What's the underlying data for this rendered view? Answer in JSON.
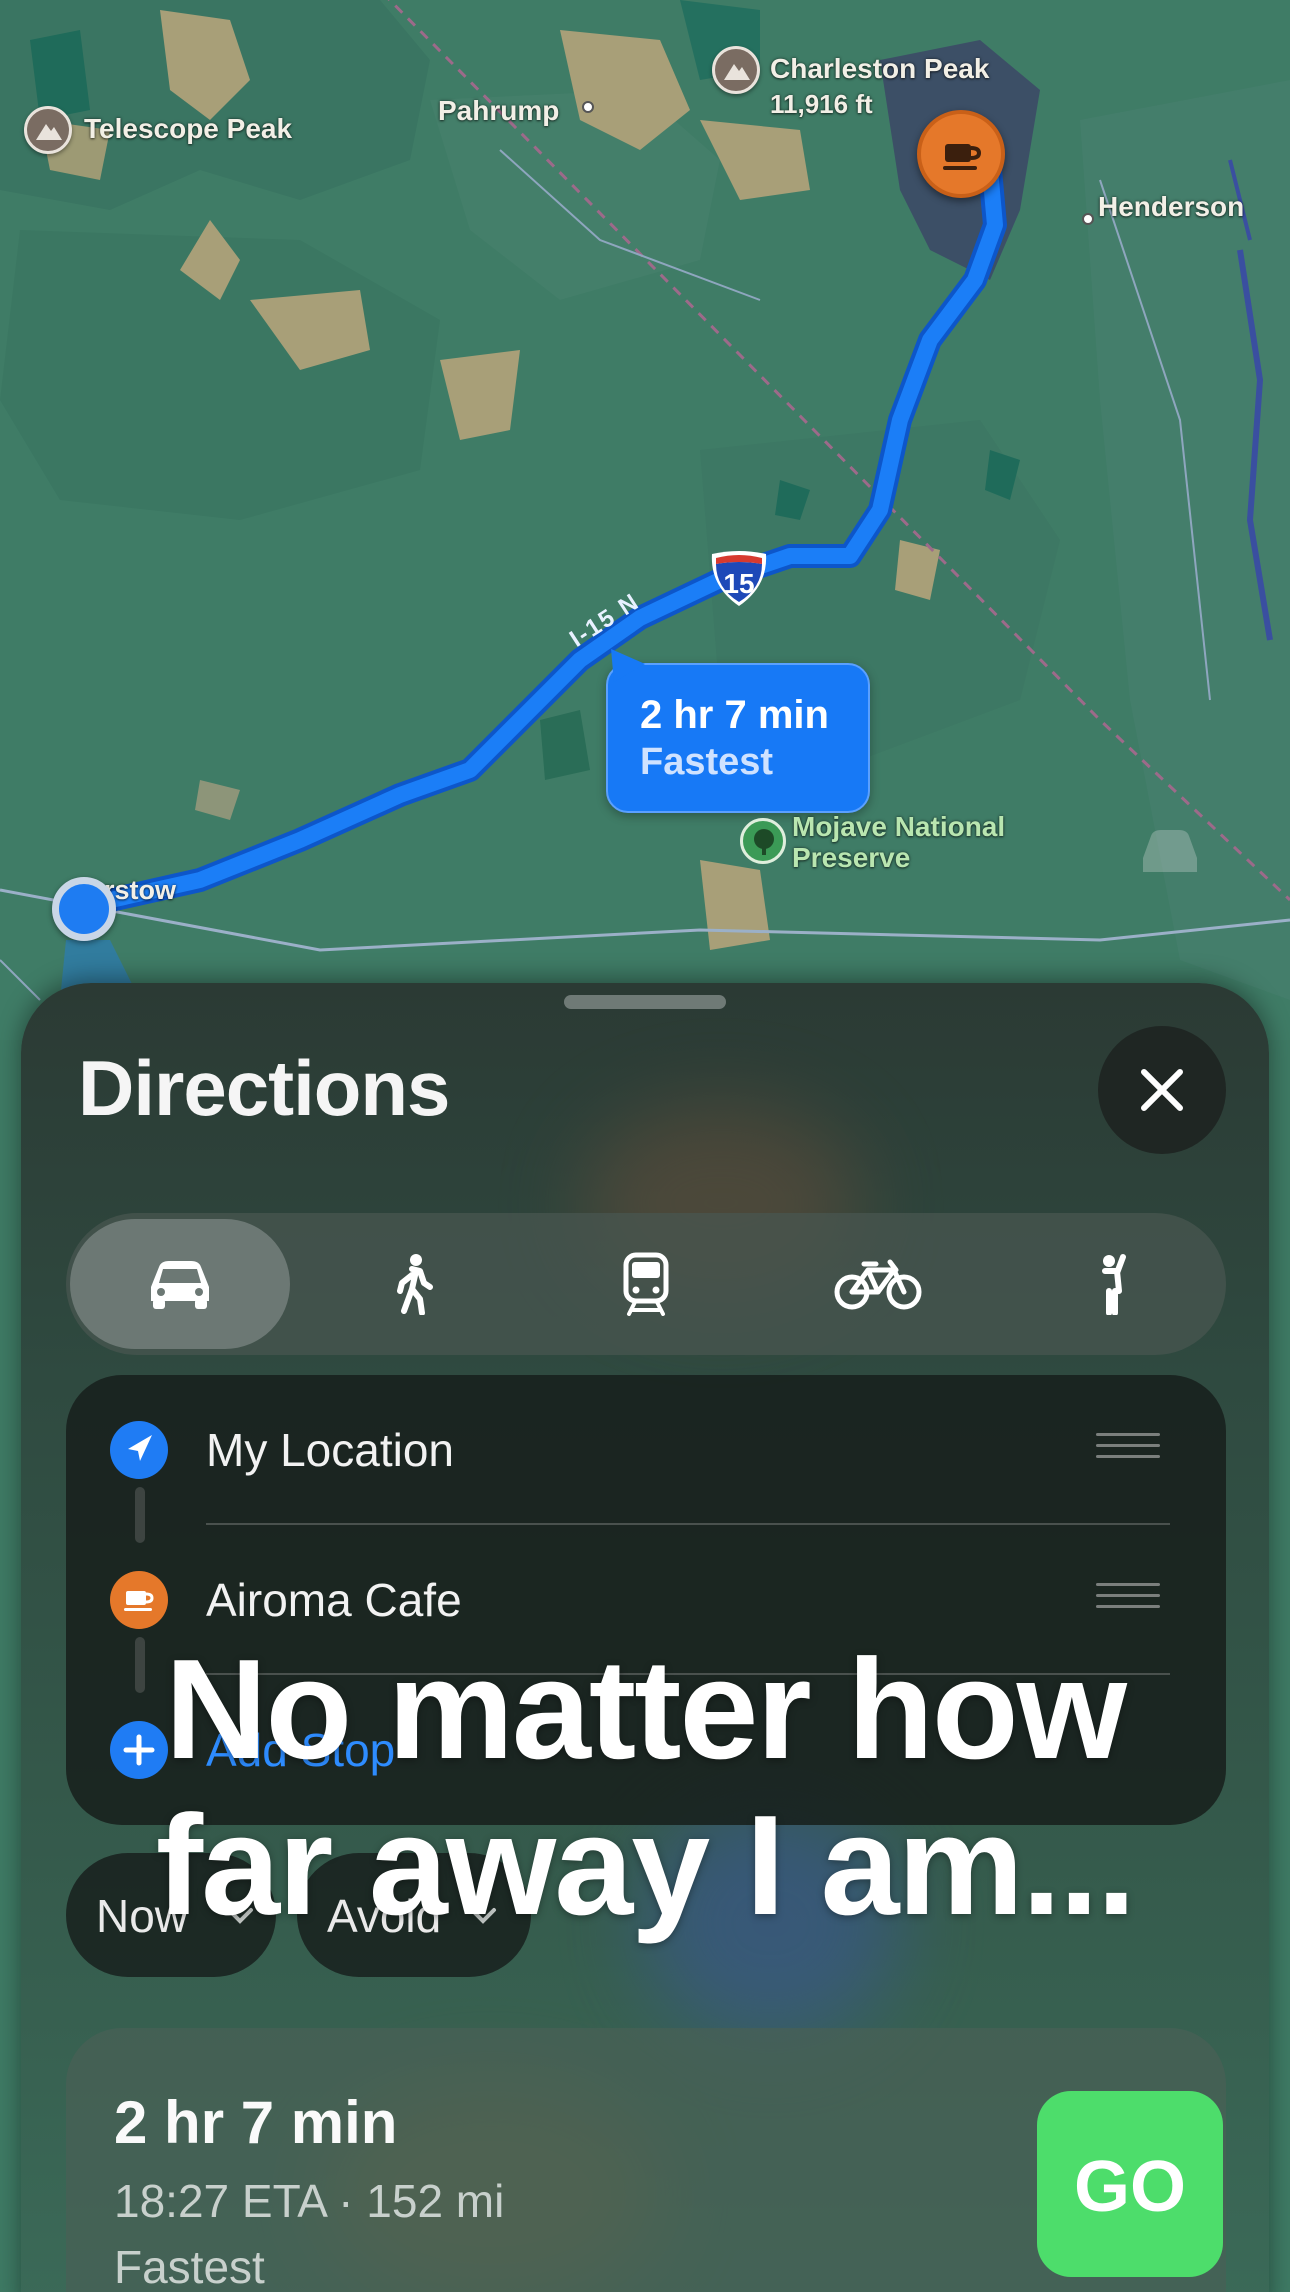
{
  "map": {
    "labels": {
      "telescope_peak": "Telescope Peak",
      "pahrump": "Pahrump",
      "charleston_peak": "Charleston Peak",
      "charleston_elev": "11,916 ft",
      "henderson": "Henderson",
      "barstow_partial": "rstow",
      "mojave": "Mojave National",
      "mojave2": "Preserve",
      "road": "I-15 N",
      "shield": "15"
    },
    "route_callout": {
      "time": "2 hr 7 min",
      "tag": "Fastest"
    },
    "colors": {
      "route": "#1779f6",
      "destination": "#e5782a"
    }
  },
  "sheet": {
    "title": "Directions",
    "modes": [
      "car-icon",
      "walk-icon",
      "transit-icon",
      "bike-icon",
      "rideshare-icon"
    ],
    "selected_mode": "car",
    "waypoints": {
      "from": "My Location",
      "to": "Airoma Cafe",
      "add_stop": "Add Stop"
    },
    "options": {
      "time": "Now",
      "avoid": "Avoid"
    },
    "route": {
      "time": "2 hr 7 min",
      "eta": "18:27 ETA · 152 mi",
      "tag": "Fastest",
      "go": "GO"
    }
  },
  "caption": {
    "line1": "No matter how",
    "line2": "far away I am..."
  }
}
